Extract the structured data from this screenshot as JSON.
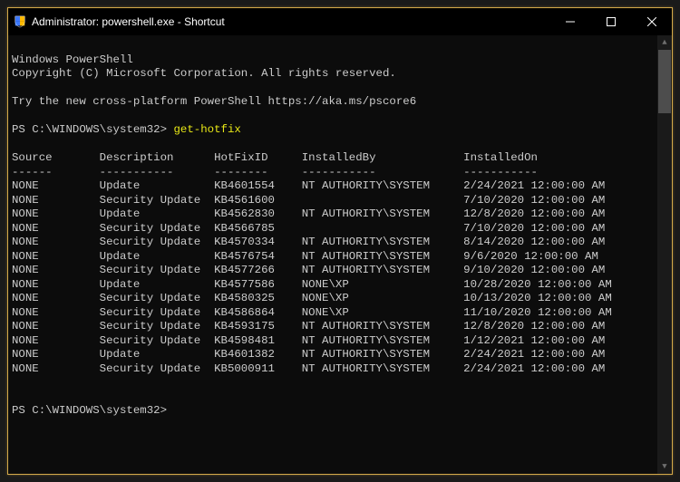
{
  "window": {
    "title": "Administrator: powershell.exe - Shortcut"
  },
  "banner": {
    "line1": "Windows PowerShell",
    "line2": "Copyright (C) Microsoft Corporation. All rights reserved.",
    "line3": "Try the new cross-platform PowerShell https://aka.ms/pscore6"
  },
  "prompt1": {
    "path": "PS C:\\WINDOWS\\system32> ",
    "command": "get-hotfix"
  },
  "headers": {
    "source": "Source",
    "description": "Description",
    "hotfixid": "HotFixID",
    "installedby": "InstalledBy",
    "installedon": "InstalledOn"
  },
  "separators": {
    "source": "------",
    "description": "-----------",
    "hotfixid": "--------",
    "installedby": "-----------",
    "installedon": "-----------"
  },
  "rows": [
    {
      "source": "NONE",
      "description": "Update",
      "hotfixid": "KB4601554",
      "installedby": "NT AUTHORITY\\SYSTEM",
      "installedon": "2/24/2021 12:00:00 AM"
    },
    {
      "source": "NONE",
      "description": "Security Update",
      "hotfixid": "KB4561600",
      "installedby": "",
      "installedon": "7/10/2020 12:00:00 AM"
    },
    {
      "source": "NONE",
      "description": "Update",
      "hotfixid": "KB4562830",
      "installedby": "NT AUTHORITY\\SYSTEM",
      "installedon": "12/8/2020 12:00:00 AM"
    },
    {
      "source": "NONE",
      "description": "Security Update",
      "hotfixid": "KB4566785",
      "installedby": "",
      "installedon": "7/10/2020 12:00:00 AM"
    },
    {
      "source": "NONE",
      "description": "Security Update",
      "hotfixid": "KB4570334",
      "installedby": "NT AUTHORITY\\SYSTEM",
      "installedon": "8/14/2020 12:00:00 AM"
    },
    {
      "source": "NONE",
      "description": "Update",
      "hotfixid": "KB4576754",
      "installedby": "NT AUTHORITY\\SYSTEM",
      "installedon": "9/6/2020 12:00:00 AM"
    },
    {
      "source": "NONE",
      "description": "Security Update",
      "hotfixid": "KB4577266",
      "installedby": "NT AUTHORITY\\SYSTEM",
      "installedon": "9/10/2020 12:00:00 AM"
    },
    {
      "source": "NONE",
      "description": "Update",
      "hotfixid": "KB4577586",
      "installedby": "NONE\\XP",
      "installedon": "10/28/2020 12:00:00 AM"
    },
    {
      "source": "NONE",
      "description": "Security Update",
      "hotfixid": "KB4580325",
      "installedby": "NONE\\XP",
      "installedon": "10/13/2020 12:00:00 AM"
    },
    {
      "source": "NONE",
      "description": "Security Update",
      "hotfixid": "KB4586864",
      "installedby": "NONE\\XP",
      "installedon": "11/10/2020 12:00:00 AM"
    },
    {
      "source": "NONE",
      "description": "Security Update",
      "hotfixid": "KB4593175",
      "installedby": "NT AUTHORITY\\SYSTEM",
      "installedon": "12/8/2020 12:00:00 AM"
    },
    {
      "source": "NONE",
      "description": "Security Update",
      "hotfixid": "KB4598481",
      "installedby": "NT AUTHORITY\\SYSTEM",
      "installedon": "1/12/2021 12:00:00 AM"
    },
    {
      "source": "NONE",
      "description": "Update",
      "hotfixid": "KB4601382",
      "installedby": "NT AUTHORITY\\SYSTEM",
      "installedon": "2/24/2021 12:00:00 AM"
    },
    {
      "source": "NONE",
      "description": "Security Update",
      "hotfixid": "KB5000911",
      "installedby": "NT AUTHORITY\\SYSTEM",
      "installedon": "2/24/2021 12:00:00 AM"
    }
  ],
  "prompt2": {
    "path": "PS C:\\WINDOWS\\system32> "
  },
  "cols": {
    "source": 13,
    "description": 17,
    "hotfixid": 13,
    "installedby": 24
  }
}
